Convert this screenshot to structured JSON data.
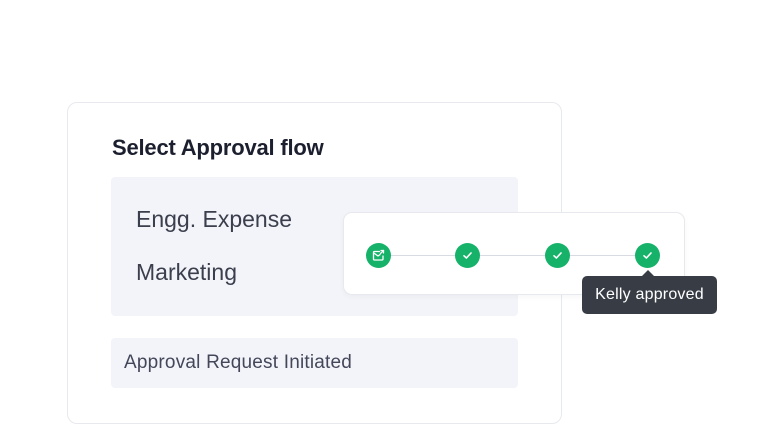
{
  "approval_card": {
    "title": "Select Approval flow",
    "flows": [
      {
        "label": "Engg. Expense"
      },
      {
        "label": "Marketing"
      }
    ],
    "status_text": "Approval Request Initiated"
  },
  "progress": {
    "steps": [
      {
        "icon": "send-mail-icon",
        "state": "complete"
      },
      {
        "icon": "check-icon",
        "state": "complete"
      },
      {
        "icon": "check-icon",
        "state": "complete"
      },
      {
        "icon": "check-icon",
        "state": "complete"
      }
    ],
    "tooltip": "Kelly approved"
  },
  "colors": {
    "step_green": "#17b26a",
    "tooltip_bg": "#383d45",
    "panel_bg": "#f3f4f9",
    "title_text": "#1c1f2e"
  }
}
